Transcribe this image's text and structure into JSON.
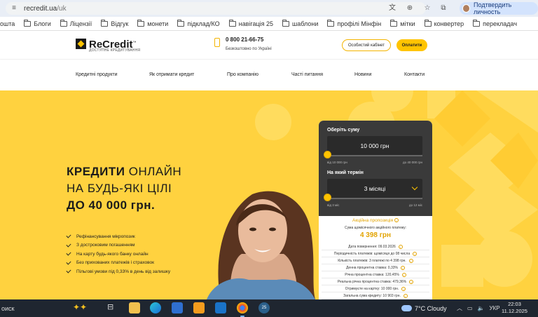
{
  "browser": {
    "url_host": "recredit.ua",
    "url_path": "/uk",
    "profile_label": "Подтвердить личность",
    "bookmarks": [
      "ошта",
      "Блоги",
      "Ліцензії",
      "Відгук",
      "монети",
      "підклад/КО",
      "навігація 25",
      "шаблони",
      "профілі Мінфін",
      "мітки",
      "конвертер",
      "перекладач"
    ]
  },
  "header": {
    "logo_text": "ReCredit",
    "logo_tm": "™",
    "logo_sub": "ДОСТУПНЕ КРЕДИТУВАННЯ",
    "phone": "0 800 21-66-75",
    "phone_sub": "Безкоштовно по Україні",
    "cabinet_btn": "Особистий кабінет",
    "pay_btn": "Оплатити"
  },
  "nav": {
    "items": [
      "Кредитні продукти",
      "Як отримати кредит",
      "Про компанію",
      "Часті питання",
      "Новини",
      "Контакти"
    ]
  },
  "hero": {
    "title_bold_1": "КРЕДИТИ",
    "title_light_1": " ОНЛАЙН",
    "title_light_2": "НА БУДЬ-ЯКІ ЦІЛІ",
    "title_bold_3": "ДО 40 000 грн.",
    "features": [
      "Рефінансування мікропозик",
      "З достроковим погашенням",
      "На карту будь-якого банку онлайн",
      "Без прихованих платежів і страховок",
      "Пільгові умови під 0,33% в день від залишку"
    ]
  },
  "calculator": {
    "amount_label": "Оберіть суму",
    "amount_value": "10 000 грн",
    "amount_min": "від 10 000 грн",
    "amount_max": "до 40 000 грн",
    "amount_slider_fraction": 0,
    "term_label": "На який термін",
    "term_value": "3 місяці",
    "term_min": "від 3 міс",
    "term_max": "до 12 міс",
    "term_slider_fraction": 0,
    "promo_title": "Акційна пропозиція",
    "promo_sub": "Сума щомісячного акційного платежу:",
    "promo_sum": "4 398 грн",
    "rows": [
      "Дата повернення: 09.03.2026",
      "Періодичність платежів: щомісяця до 08 числа",
      "Кількість платежів: 3 платежі по 4 398 грн.",
      "Денна процентна ставка: 0,33%",
      "Річна процентна ставка: 120,45%",
      "Реальна річна процентна ставка: 479,36%",
      "Отримуєте на картку: 10 000 грн.",
      "Загальна сума кредиту: 10 903 грн."
    ]
  },
  "taskbar": {
    "search_text": "оиск",
    "weather": "7°C  Cloudy",
    "lang": "УКР",
    "time": "22:03",
    "date": "11.12.2025",
    "badge": "25"
  },
  "colors": {
    "brand_yellow": "#ffd23f",
    "accent": "#ffc400",
    "calc_dark": "#3a3a3a"
  }
}
